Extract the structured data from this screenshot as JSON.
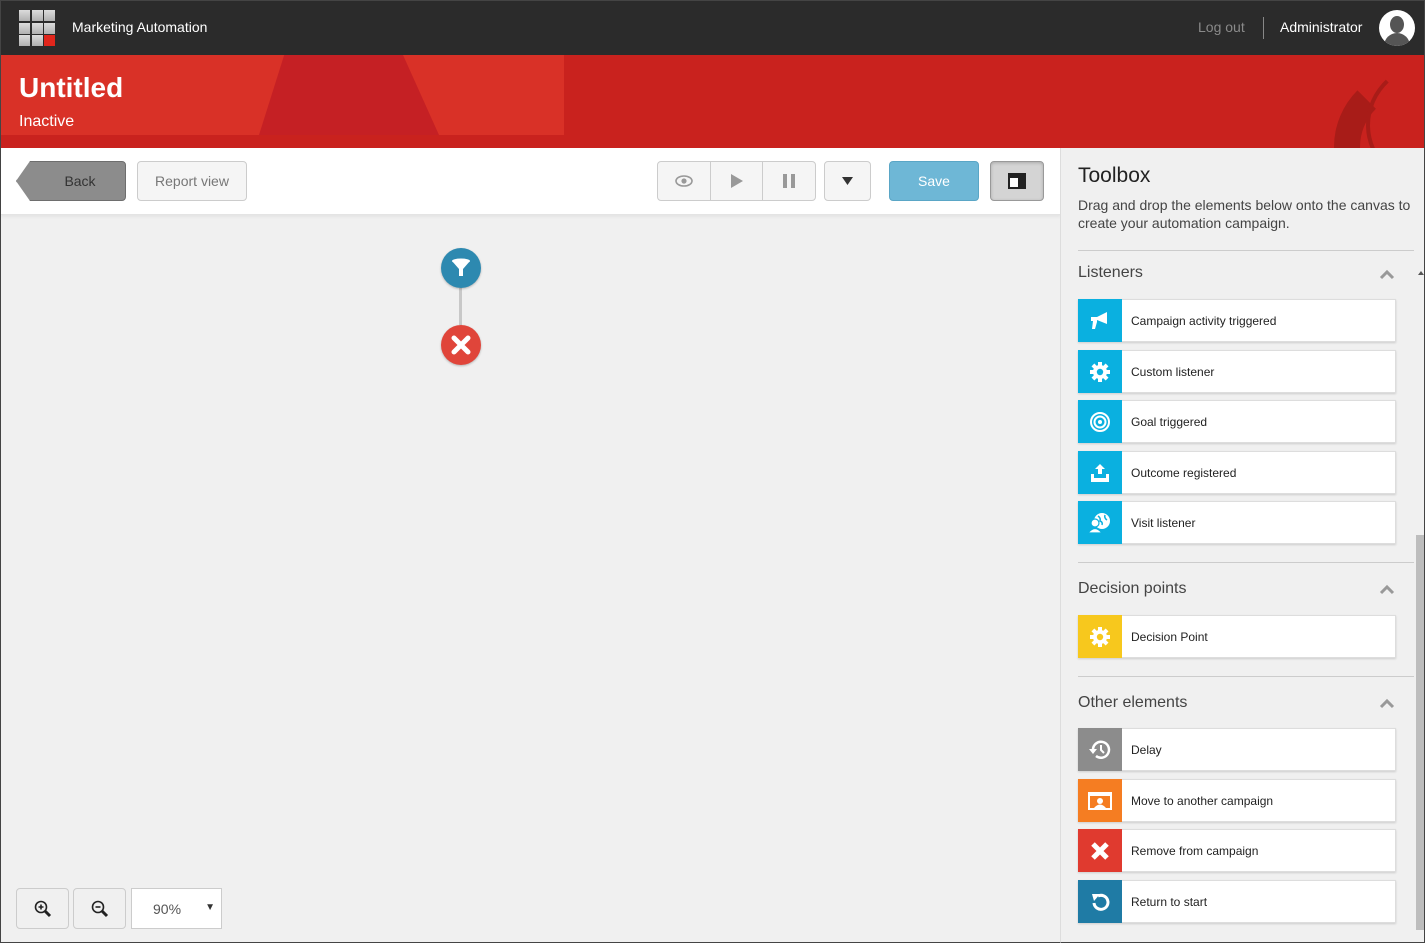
{
  "topbar": {
    "app_title": "Marketing Automation",
    "logout_label": "Log out",
    "username": "Administrator"
  },
  "header": {
    "title": "Untitled",
    "status": "Inactive"
  },
  "toolbar": {
    "back_label": "Back",
    "report_view_label": "Report view",
    "preview_icon": "eye-icon",
    "start_icon": "play-icon",
    "pause_icon": "pause-icon",
    "dropdown_icon": "caret-down-icon",
    "save_label": "Save",
    "panel_toggle_icon": "panel-layout-icon"
  },
  "canvas": {
    "nodes": [
      {
        "type": "start",
        "icon": "funnel-icon",
        "color": "#2d89b0"
      },
      {
        "type": "end",
        "icon": "close-icon",
        "color": "#e0453a"
      }
    ],
    "zoom": {
      "zoom_in_icon": "zoom-in-icon",
      "zoom_out_icon": "zoom-out-icon",
      "level": "90%"
    }
  },
  "toolbox": {
    "title": "Toolbox",
    "description": "Drag and drop the elements below onto the canvas to create your automation campaign.",
    "sections": [
      {
        "title": "Listeners",
        "color": "#0ab0e0",
        "items": [
          {
            "label": "Campaign activity triggered",
            "icon": "megaphone-icon"
          },
          {
            "label": "Custom listener",
            "icon": "gear-icon"
          },
          {
            "label": "Goal triggered",
            "icon": "target-icon"
          },
          {
            "label": "Outcome registered",
            "icon": "upload-tray-icon"
          },
          {
            "label": "Visit listener",
            "icon": "globe-user-icon"
          }
        ]
      },
      {
        "title": "Decision points",
        "color": "#f7c81d",
        "items": [
          {
            "label": "Decision Point",
            "icon": "gear-icon"
          }
        ]
      },
      {
        "title": "Other elements",
        "items": [
          {
            "label": "Delay",
            "icon": "history-icon",
            "color": "#8c8c8c"
          },
          {
            "label": "Move to another campaign",
            "icon": "user-window-icon",
            "color": "#f57d22"
          },
          {
            "label": "Remove from campaign",
            "icon": "close-icon",
            "color": "#e03a2f"
          },
          {
            "label": "Return to start",
            "icon": "rotate-left-icon",
            "color": "#1f7ba5"
          }
        ]
      }
    ]
  }
}
